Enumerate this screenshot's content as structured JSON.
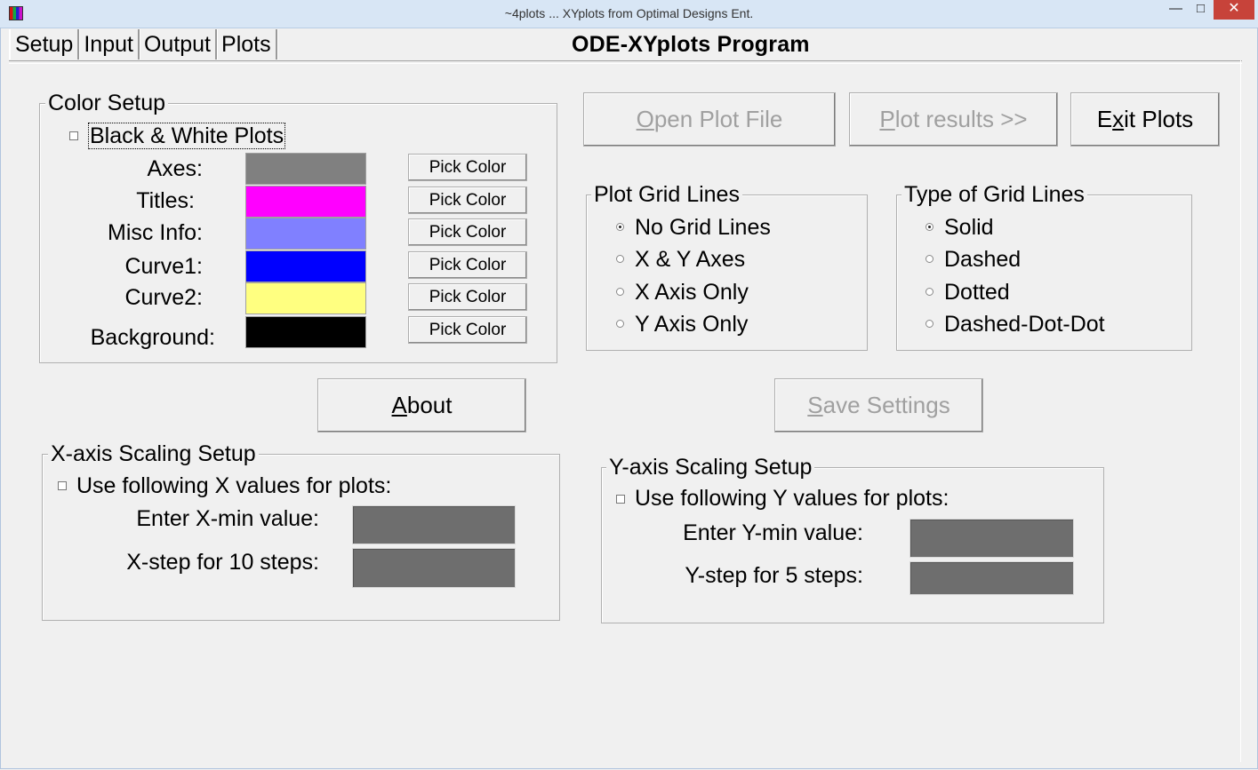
{
  "window": {
    "title": "~4plots ... XYplots from Optimal Designs Ent.",
    "minimize": "—",
    "maximize": "□",
    "close": "✕"
  },
  "tabs": [
    "Setup",
    "Input",
    "Output",
    "Plots"
  ],
  "program_title": "ODE-XYplots Program",
  "color_setup": {
    "legend": "Color Setup",
    "bw_label": "Black & White Plots",
    "bw_checked": false,
    "pick_label": "Pick Color",
    "rows": [
      {
        "label": "Axes:",
        "color": "#808080"
      },
      {
        "label": "Titles:",
        "color": "#ff00ff"
      },
      {
        "label": "Misc Info:",
        "color": "#8080ff"
      },
      {
        "label": "Curve1:",
        "color": "#0000ff"
      },
      {
        "label": "Curve2:",
        "color": "#ffff80"
      },
      {
        "label": "Background:",
        "color": "#000000"
      }
    ]
  },
  "buttons": {
    "open_plot_file": {
      "pre": "",
      "accel": "O",
      "post": "pen Plot File",
      "enabled": false
    },
    "plot_results": {
      "pre": "",
      "accel": "P",
      "post": "lot results >>",
      "enabled": false
    },
    "exit_plots": {
      "pre": "E",
      "accel": "x",
      "post": "it Plots",
      "enabled": true
    },
    "about": {
      "pre": "",
      "accel": "A",
      "post": "bout",
      "enabled": true
    },
    "save_settings": {
      "pre": "",
      "accel": "S",
      "post": "ave Settings",
      "enabled": false
    }
  },
  "plot_grid_lines": {
    "legend": "Plot Grid Lines",
    "options": [
      "No Grid Lines",
      "X & Y Axes",
      "X Axis Only",
      "Y Axis Only"
    ],
    "selected": 0
  },
  "type_of_grid_lines": {
    "legend": "Type of Grid Lines",
    "options": [
      "Solid",
      "Dashed",
      "Dotted",
      "Dashed-Dot-Dot"
    ],
    "selected": 0
  },
  "x_axis": {
    "legend": "X-axis Scaling Setup",
    "use_label": "Use following X values for plots:",
    "use_checked": false,
    "min_label": "Enter X-min value:",
    "step_label": "X-step for 10 steps:",
    "min_value": "",
    "step_value": ""
  },
  "y_axis": {
    "legend": "Y-axis Scaling Setup",
    "use_label": "Use following Y values for plots:",
    "use_checked": false,
    "min_label": "Enter Y-min value:",
    "step_label": "Y-step for 5 steps:",
    "min_value": "",
    "step_value": ""
  },
  "colors": {
    "field_bg": "#6e6e6e",
    "disabled_text": "#a0a0a0"
  }
}
